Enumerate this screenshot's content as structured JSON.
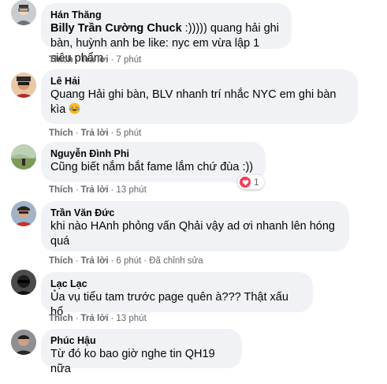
{
  "comments": [
    {
      "author": "Hán Thăng",
      "mention": "Billy Trần Cường Chuck",
      "text": " :))))) quang hải ghi bàn, huỳnh anh be like: nyc em vừa lập 1 siêu phẩm",
      "like": "Thích",
      "reply": "Trả lời",
      "time": "7 phút"
    },
    {
      "author": "Lê Hải",
      "text": "Quang Hải ghi bàn, BLV nhanh trí nhắc NYC em ghi bàn kìa",
      "emoji": "laughing-emoji",
      "like": "Thích",
      "reply": "Trả lời",
      "time": "5 phút"
    },
    {
      "author": "Nguyễn Đình Phi",
      "text": "Cũng biết nắm bắt fame lắm chứ đùa :))",
      "like": "Thích",
      "reply": "Trả lời",
      "time": "13 phút",
      "reaction_count": "1",
      "reaction": "heart-icon"
    },
    {
      "author": "Trần Văn Đức",
      "text": "khi nào HAnh phỏng vấn Qhải vậy ad ơi nhanh lên hóng quá",
      "like": "Thích",
      "reply": "Trả lời",
      "time": "6 phút",
      "edited": "Đã chỉnh sửa"
    },
    {
      "author": "Lạc Lạc",
      "text": "Ủa vụ tiểu tam trước page quên à??? Thật xấu hổ",
      "like": "Thích",
      "reply": "Trả lời",
      "time": "13 phút"
    },
    {
      "author": "Phúc Hậu",
      "text": "Từ đó ko bao giờ nghe tin QH19 nữa"
    }
  ],
  "separator": "·",
  "colors": {
    "bubble": "#f0f2f5",
    "meta": "#65676b",
    "heart": "#f33e58"
  }
}
